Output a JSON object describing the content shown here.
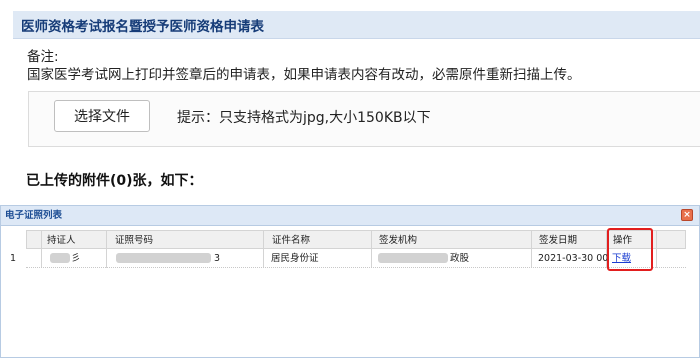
{
  "page": {
    "title": "医师资格考试报名暨授予医师资格申请表"
  },
  "note": {
    "label": "备注:",
    "text": "国家医学考试网上打印并签章后的申请表，如果申请表内容有改动，必需原件重新扫描上传。"
  },
  "upload": {
    "choose_button": "选择文件",
    "hint": "提示：只支持格式为jpg,大小150KB以下"
  },
  "uploaded_title": "已上传的附件(0)张，如下：",
  "panel": {
    "title": "电子证照列表",
    "close_icon": "close-icon"
  },
  "table": {
    "headers": {
      "holder": "持证人",
      "cert_no": "证照号码",
      "cert_name": "证件名称",
      "issuer": "签发机构",
      "issue_date": "签发日期",
      "action": "操作"
    },
    "rows": [
      {
        "index": "1",
        "holder_suffix": "彡",
        "cert_no_suffix": "3",
        "cert_name": "居民身份证",
        "issuer_suffix": "政股",
        "issue_date": "2021-03-30 00",
        "action": "下载"
      }
    ]
  },
  "colors": {
    "highlight": "#e21e1e",
    "link": "#1a3cd0",
    "header_bg": "#dfe9f5"
  }
}
